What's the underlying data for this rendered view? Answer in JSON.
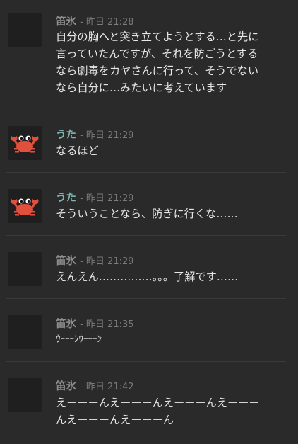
{
  "messages": [
    {
      "author": "笛氷",
      "time": "- 昨日 21:28",
      "text": "自分の胸へと突き立てようとする…と先に\n言っていたんですが、それを防ごうとする\nなら劇毒をカヤさんに行って、そうでない\nなら自分に…みたいに考えています"
    },
    {
      "author": "うた",
      "time": "- 昨日 21:29",
      "text": "なるほど"
    },
    {
      "author": "うた",
      "time": "- 昨日 21:29",
      "text": "そういうことなら、防ぎに行くな……"
    },
    {
      "author": "笛氷",
      "time": "- 昨日 21:29",
      "text": "えんえん……………。。。了解です……"
    },
    {
      "author": "笛氷",
      "time": "- 昨日 21:35",
      "text": "ｳｰｰｰﾝｳｰｰｰﾝ"
    },
    {
      "author": "笛氷",
      "time": "- 昨日 21:42",
      "text": "えーーーんえーーーんえーーーんえーーー\nんえーーーんえーーーん"
    }
  ],
  "colors": {
    "background": "#2a2a2a",
    "author_default": "#8f8f8f",
    "author_teal": "#7fb3b0",
    "crab": "#e0503c"
  },
  "icons": {
    "crab_avatar": "crab-icon",
    "blank_avatar": "dark-square-avatar"
  }
}
